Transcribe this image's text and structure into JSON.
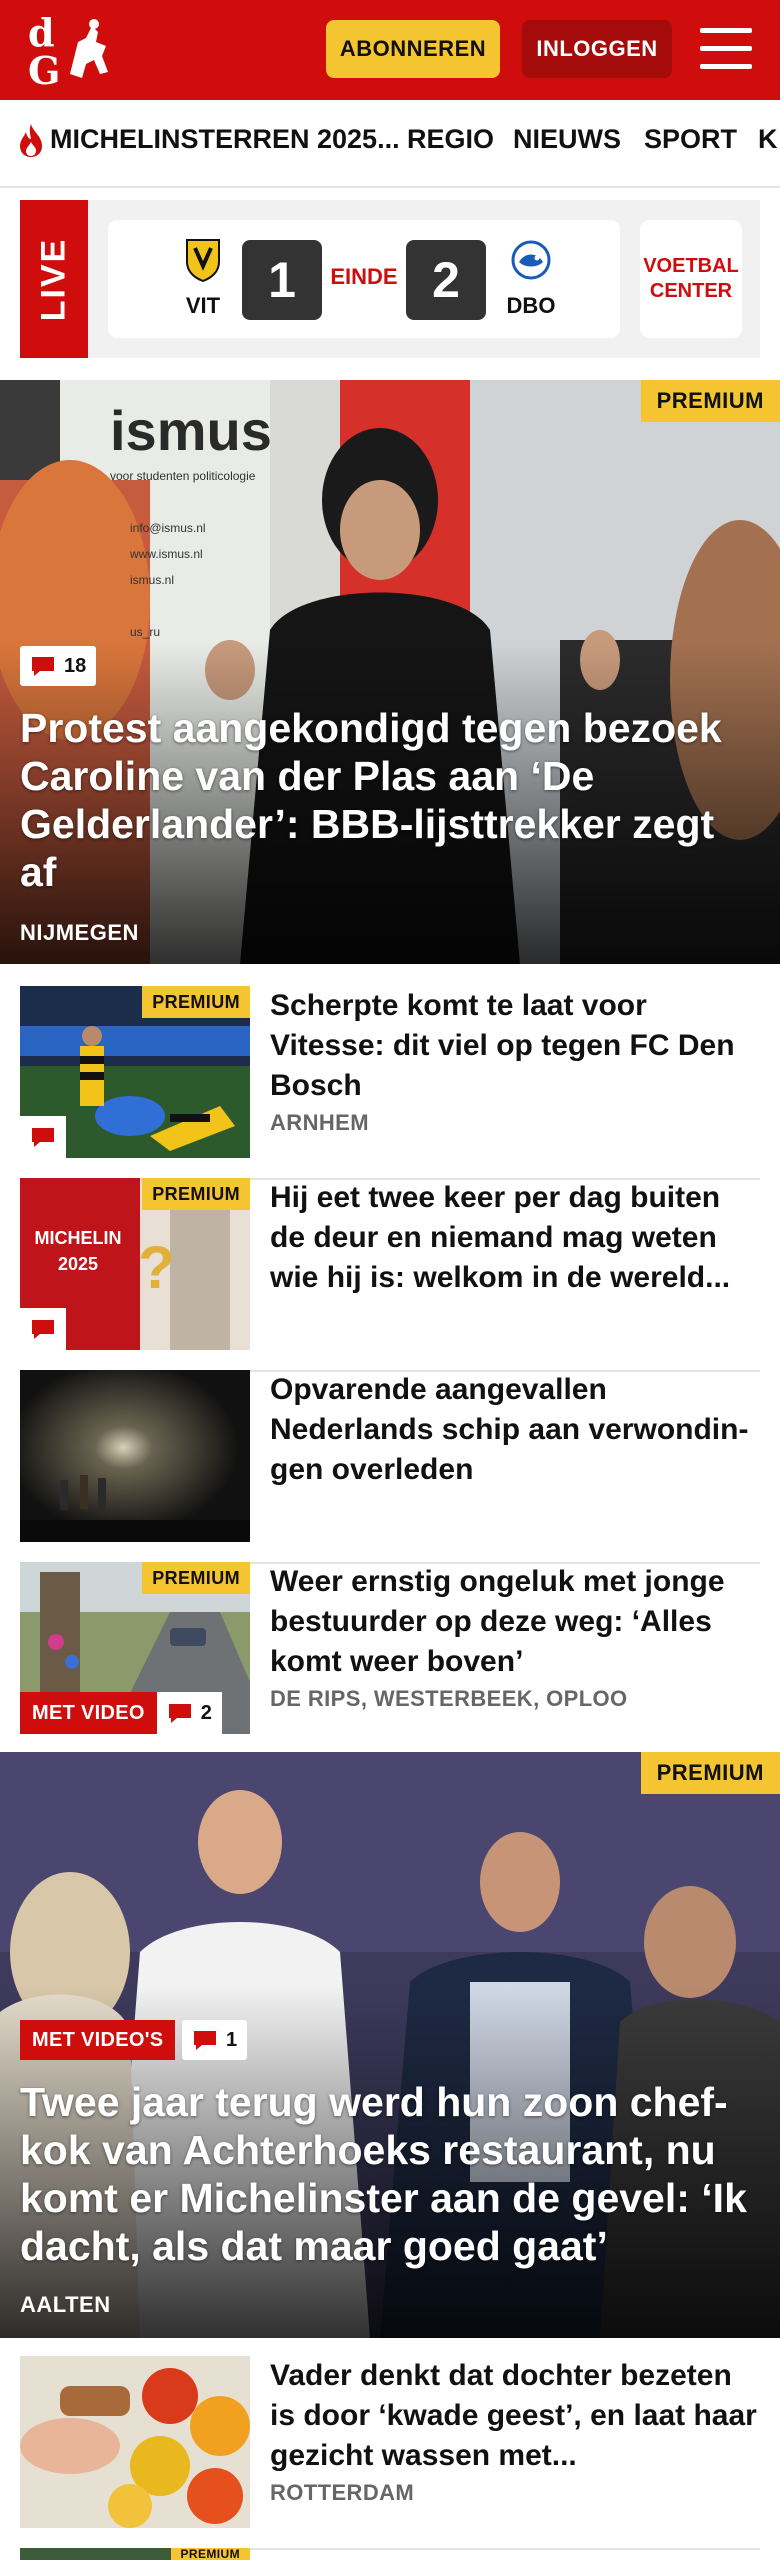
{
  "header": {
    "subscribe_label": "ABONNEREN",
    "login_label": "INLOGGEN",
    "logo_icon": "dg-logo-icon",
    "menu_icon": "hamburger-menu-icon",
    "brand_color": "#cf0d0d",
    "accent_color": "#f4c431"
  },
  "nav": {
    "items": [
      {
        "label": "MICHELINSTERREN 2025...",
        "icon": "flame-icon"
      },
      {
        "label": "REGIO"
      },
      {
        "label": "NIEUWS"
      },
      {
        "label": "SPORT"
      },
      {
        "label": "K"
      }
    ]
  },
  "live": {
    "label": "LIVE",
    "home_team": "VIT",
    "away_team": "DBO",
    "home_score": "1",
    "away_score": "2",
    "status": "EINDE",
    "center_label_1": "VOETBAL",
    "center_label_2": "CENTER"
  },
  "hero1": {
    "badge": "PREMIUM",
    "comments": "18",
    "title": "Protest aangekondigd tegen bezoek Caroline van der Plas aan ‘De Gelderlander’: BBB-lijsttrekker zegt af",
    "location": "NIJMEGEN",
    "banner_text": "ismus",
    "banner_sub": "voor studenten politicologie",
    "banner_lines": [
      "info@ismus.nl",
      "www.ismus.nl",
      "ismus.nl",
      "us_ru"
    ]
  },
  "articles": [
    {
      "title": "Scherpte komt te laat voor Vitesse: dit viel op tegen FC Den Bosch",
      "location": "ARNHEM",
      "premium": "PREMIUM"
    },
    {
      "title": "Hij eet twee keer per dag buiten de deur en niemand mag weten wie hij is: welkom in de wereld...",
      "location": "",
      "premium": "PREMIUM",
      "thumb_text_1": "MICHELIN",
      "thumb_text_2": "2025"
    },
    {
      "title": "Opvarende aangevallen Nederlands schip aan verwondin-gen overleden",
      "location": ""
    },
    {
      "title": "Weer ernstig ongeluk met jonge bestuurder op deze weg: ‘Alles komt weer boven’",
      "location": "DE RIPS, WESTERBEEK, OPLOO",
      "premium": "PREMIUM",
      "video": "MET VIDEO",
      "comments": "2"
    }
  ],
  "hero2": {
    "badge": "PREMIUM",
    "video": "MET VIDEO'S",
    "comments": "1",
    "title": "Twee jaar terug werd hun zoon chef-kok van Achterhoeks restaurant, nu komt er Michelinster aan de gevel: ‘Ik dacht, als dat maar goed gaat’",
    "location": "AALTEN"
  },
  "article5": {
    "title": "Vader denkt dat dochter bezeten is door ‘kwade geest’, en laat haar gezicht wassen met...",
    "location": "ROTTERDAM"
  },
  "article6": {
    "premium": "PREMIUM"
  }
}
